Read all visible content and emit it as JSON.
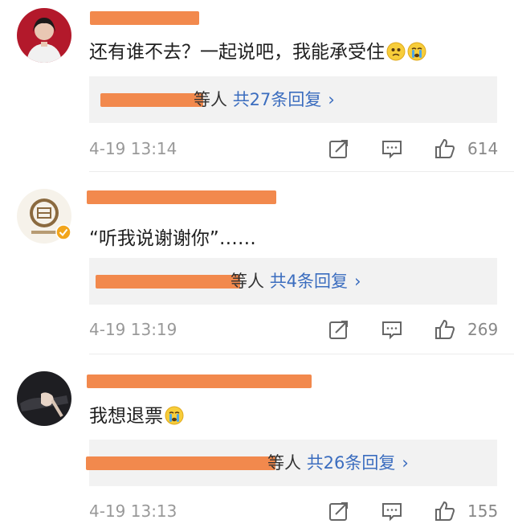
{
  "comments": [
    {
      "text": "还有谁不去？一起说吧，我能承受住",
      "emojis": [
        "sad-face-icon",
        "crying-face-icon"
      ],
      "reply": {
        "suffix": "等人",
        "count": "共27条回复",
        "chevron": "›"
      },
      "timestamp": "4-19 13:14",
      "likes": "614"
    },
    {
      "text": "“听我说谢谢你”……",
      "emojis": [],
      "reply": {
        "suffix": "等人",
        "count": "共4条回复",
        "chevron": "›"
      },
      "timestamp": "4-19 13:19",
      "likes": "269"
    },
    {
      "text": "我想退票",
      "emojis": [
        "crying-face-icon"
      ],
      "reply": {
        "suffix": "等人",
        "count": "共26条回复",
        "chevron": "›"
      },
      "timestamp": "4-19 13:13",
      "likes": "155"
    }
  ],
  "colors": {
    "redaction": "#f2894d",
    "link_blue": "#3b6dbf",
    "meta_gray": "#999999",
    "reply_bg": "#f2f2f2"
  },
  "icons": {
    "repost": "repost-icon",
    "comment": "comment-icon",
    "like": "like-icon",
    "verified": "verified-badge-icon"
  }
}
